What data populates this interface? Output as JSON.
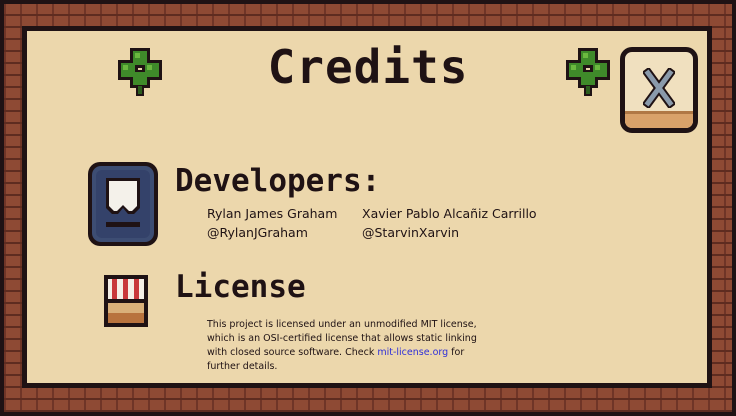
{
  "screen": {
    "title": "Credits"
  },
  "developers": {
    "heading": "Developers:",
    "people": [
      {
        "name": "Rylan James Graham",
        "handle": "@RylanJGraham"
      },
      {
        "name": "Xavier Pablo Alcañiz Carrillo",
        "handle": "@StarvinXarvin"
      }
    ]
  },
  "license": {
    "heading": "License",
    "text_before_link": "This project is licensed under an unmodified MIT license, which is an OSI-certified license that allows static linking with closed source software. Check ",
    "link_text": "mit-license.org",
    "text_after_link": " for further details."
  },
  "icons": {
    "clover": "clover-icon",
    "close": "close-x-icon",
    "developer": "developer-avatar-icon",
    "license": "license-shop-icon"
  },
  "colors": {
    "background": "#ecd7ac",
    "border": "#1f1214",
    "brick": "#8e4a34",
    "link": "#2f2fd8",
    "leaf": "#3f8a2a"
  }
}
